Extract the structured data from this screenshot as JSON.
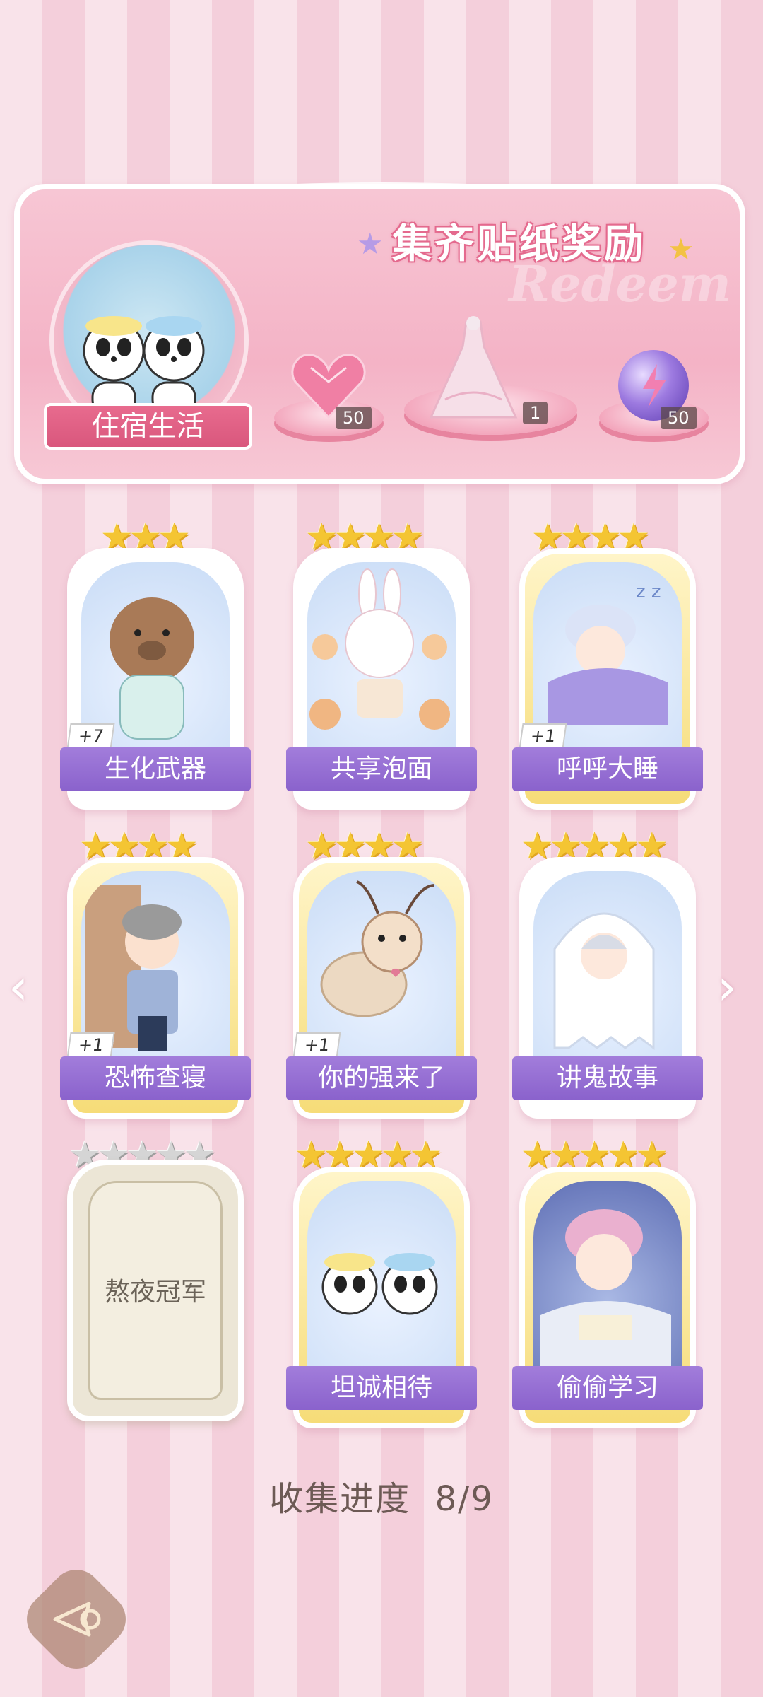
{
  "banner": {
    "title": "集齐贴纸奖励",
    "watermark": "Redeem",
    "album_name": "住宿生活",
    "rewards": [
      {
        "icon": "heart-gem-icon",
        "count": "50"
      },
      {
        "icon": "pink-gown-icon",
        "count": "1"
      },
      {
        "icon": "purple-energy-orb-icon",
        "count": "50"
      }
    ]
  },
  "cards": [
    {
      "label": "生化武器",
      "stars": 3,
      "extra": "+7",
      "frame": "white",
      "icon": "capybara-pajamas-icon"
    },
    {
      "label": "共享泡面",
      "stars": 4,
      "extra": "",
      "frame": "white",
      "icon": "bunny-noodles-icon"
    },
    {
      "label": "呼呼大睡",
      "stars": 4,
      "extra": "+1",
      "frame": "gold",
      "icon": "sleeping-boy-icon"
    },
    {
      "label": "恐怖查寝",
      "stars": 4,
      "extra": "+1",
      "frame": "gold",
      "icon": "dorm-supervisor-icon"
    },
    {
      "label": "你的强来了",
      "stars": 4,
      "extra": "+1",
      "frame": "gold",
      "icon": "cockroach-icon"
    },
    {
      "label": "讲鬼故事",
      "stars": 5,
      "extra": "",
      "frame": "white",
      "icon": "ghost-boy-icon"
    },
    {
      "label": "熬夜冠军",
      "stars": 5,
      "extra": "",
      "frame": "locked",
      "icon": "locked-card-icon"
    },
    {
      "label": "坦诚相待",
      "stars": 5,
      "extra": "",
      "frame": "gold",
      "icon": "pandas-bath-icon"
    },
    {
      "label": "偷偷学习",
      "stars": 5,
      "extra": "",
      "frame": "gold",
      "icon": "studying-boy-icon"
    }
  ],
  "progress": {
    "label": "收集进度",
    "value": "8/9",
    "collected": 8,
    "total": 9
  },
  "nav": {
    "prev_icon": "chevron-left-icon",
    "next_icon": "chevron-right-icon",
    "back_icon": "back-arrow-icon"
  }
}
